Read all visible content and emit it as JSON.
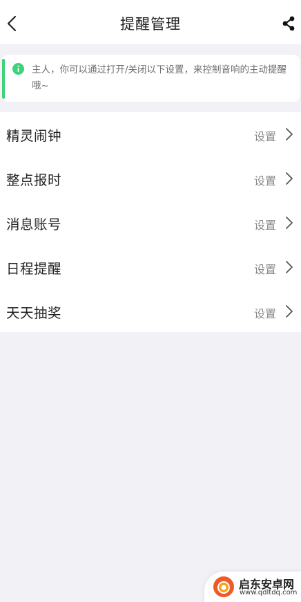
{
  "header": {
    "title": "提醒管理",
    "back_icon": "chevron-left-icon",
    "share_icon": "share-icon"
  },
  "notice": {
    "text": "主人，你可以通过打开/关闭以下设置，来控制音响的主动提醒哦~",
    "accent_color": "#3fd27a"
  },
  "settings_list": {
    "items": [
      {
        "label": "精灵闹钟",
        "action": "设置"
      },
      {
        "label": "整点报时",
        "action": "设置"
      },
      {
        "label": "消息账号",
        "action": "设置"
      },
      {
        "label": "日程提醒",
        "action": "设置"
      },
      {
        "label": "天天抽奖",
        "action": "设置"
      }
    ]
  },
  "watermark": {
    "name": "启东安卓网",
    "url": "www.qdltdq.com"
  },
  "colors": {
    "background": "#f1f1f6",
    "accent": "#3fd27a",
    "brand_watermark": "#f05a28"
  }
}
